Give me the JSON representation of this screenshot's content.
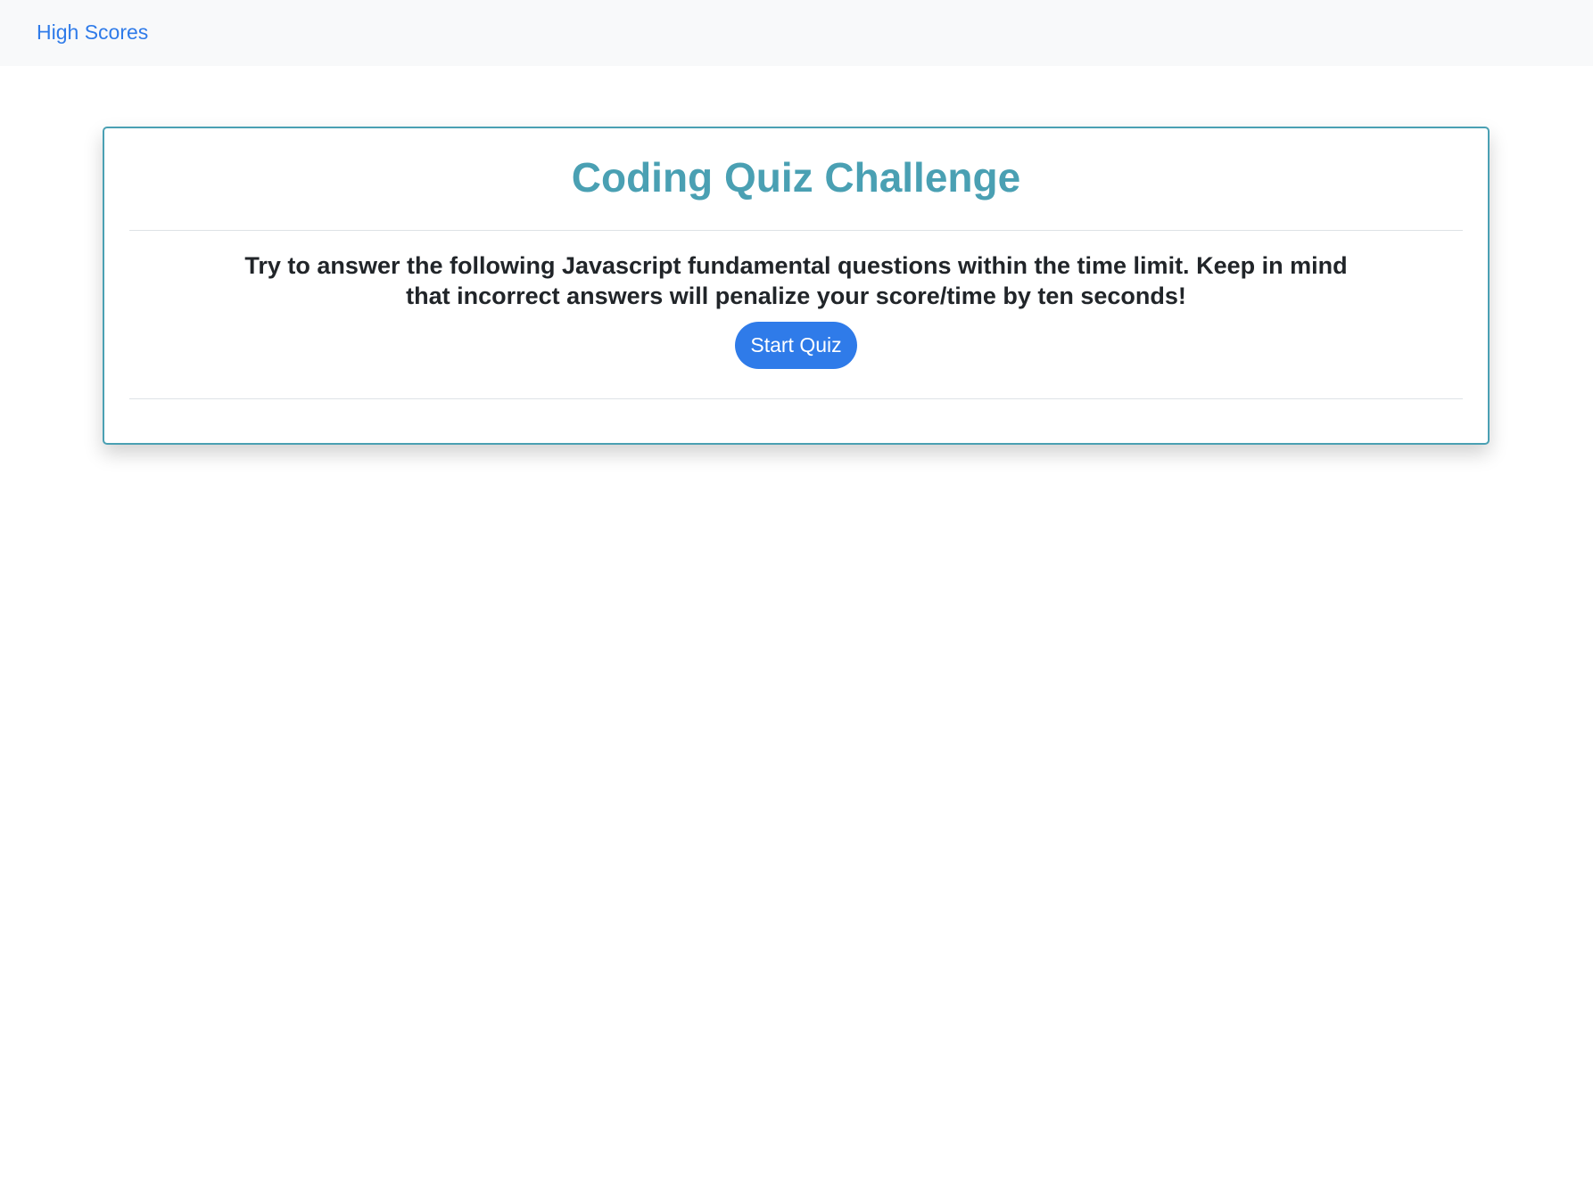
{
  "nav": {
    "high_scores_label": "High Scores"
  },
  "quiz": {
    "title": "Coding Quiz Challenge",
    "description_line1": "Try to answer the following Javascript fundamental questions within the time limit. Keep in mind",
    "description_line2": "that incorrect answers will penalize your score/time by ten seconds!",
    "start_label": "Start Quiz"
  },
  "colors": {
    "accent": "#4aa0b3",
    "link": "#2f7be9",
    "nav_background": "#f8f9fa"
  }
}
